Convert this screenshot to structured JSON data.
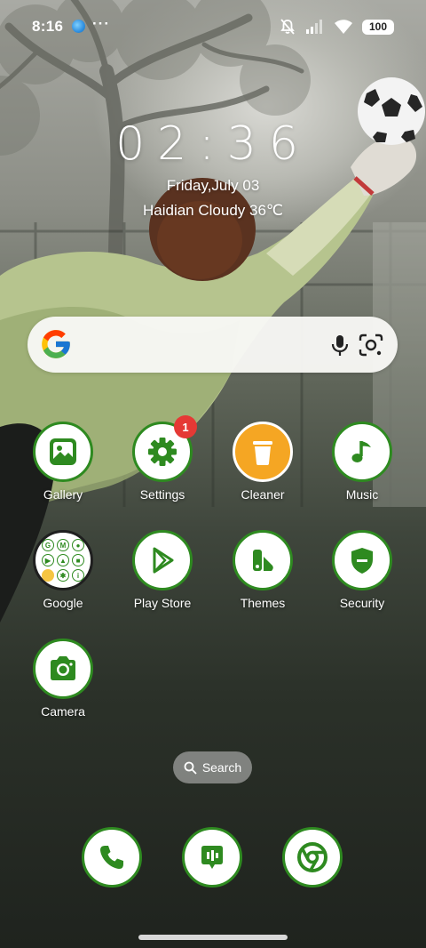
{
  "status_bar": {
    "time": "8:16",
    "more": "···",
    "battery": "100",
    "icons": [
      "globe-icon",
      "mute-icon",
      "signal-icon",
      "wifi-icon",
      "battery-icon"
    ]
  },
  "clock_widget": {
    "time": "02:36",
    "date": "Friday,July 03",
    "weather": "Haidian Cloudy 36℃"
  },
  "search_bar": {
    "icons": [
      "google-g-icon",
      "microphone-icon",
      "google-lens-icon"
    ]
  },
  "apps": [
    {
      "label": "Gallery",
      "icon": "gallery-icon"
    },
    {
      "label": "Settings",
      "icon": "gear-icon",
      "badge": "1"
    },
    {
      "label": "Cleaner",
      "icon": "trash-icon"
    },
    {
      "label": "Music",
      "icon": "music-note-icon"
    },
    {
      "label": "Google",
      "icon": "folder-icon"
    },
    {
      "label": "Play Store",
      "icon": "play-store-icon"
    },
    {
      "label": "Themes",
      "icon": "themes-icon"
    },
    {
      "label": "Security",
      "icon": "shield-icon"
    },
    {
      "label": "Camera",
      "icon": "camera-icon"
    }
  ],
  "search_pill": {
    "label": "Search"
  },
  "dock": [
    {
      "icon": "phone-icon"
    },
    {
      "icon": "messages-icon"
    },
    {
      "icon": "chrome-icon"
    }
  ],
  "colors": {
    "icon_green": "#2e8a20",
    "cleaner_orange": "#f5a623",
    "badge_red": "#e53935"
  }
}
